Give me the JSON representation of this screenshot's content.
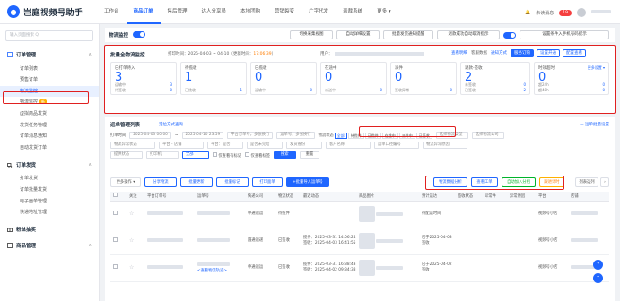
{
  "brand": {
    "logo_glyph": "●",
    "name": "岂庭视频号助手"
  },
  "topnav": [
    "工作台",
    "商品订单",
    "售后管理",
    "达人分享员",
    "本地团购",
    "营销裂变",
    "广字代发",
    "表裁系统",
    "更多 ▾"
  ],
  "topnav_active": 1,
  "top_right": {
    "message_label": "未读消息",
    "message_count": "19"
  },
  "sidebar": {
    "search_placeholder": "输入页面搜索 Q",
    "groups": [
      {
        "label": "订单管理",
        "items": [
          "订单列表",
          "预售订单",
          "物流监控",
          "物流监控 新",
          "虚拟商品发货",
          "发货任务管理",
          "订单消息通知",
          "自动发货订单"
        ]
      },
      {
        "label": "订单发货",
        "items": [
          "打单发货",
          "订单批量发货",
          "电子面单管理",
          "快递地址管理"
        ]
      },
      {
        "label": "粉丝抽奖",
        "items": []
      },
      {
        "label": "商品管理",
        "items": []
      }
    ],
    "new_tag": "新"
  },
  "toolbar": {
    "label": "物流监控",
    "buttons": [
      "切换采集视图",
      "自动详细设置",
      "批量发货通知提醒",
      "退款成功自动取消指示",
      "设置条件入手机号码提示"
    ]
  },
  "stats": {
    "title": "批量全物流监控",
    "print_label": "打印时间：",
    "date_range": "2025-04-03 ~ 04-10",
    "update_label": "（更新时间：",
    "update_time": "17:06:39",
    "update_close": "）",
    "user_label": "用户：",
    "links": [
      "查看明细",
      "客服数据",
      "通知方式"
    ],
    "btn_primary": "服务订购",
    "btn_outline1": "设置开通",
    "btn_outline2": "配置查看",
    "cards": [
      {
        "label": "已打单待入",
        "value": "3",
        "rows": [
          [
            "运输中",
            "3"
          ],
          [
            "待签收",
            "0"
          ]
        ]
      },
      {
        "label": "待揽收",
        "value": "1",
        "rows": [
          [
            "已揽收",
            "1"
          ]
        ]
      },
      {
        "label": "已揽收",
        "value": "0",
        "rows": [
          [
            "运输中",
            "0"
          ]
        ]
      },
      {
        "label": "在途中",
        "value": "0",
        "rows": [
          [
            "派送中",
            "0"
          ]
        ]
      },
      {
        "label": "派件",
        "value": "0",
        "rows": [
          [
            "签收异常",
            "0"
          ]
        ]
      },
      {
        "label": "退款-签收",
        "value": "2",
        "rows": [
          [
            "未签收",
            "0"
          ],
          [
            "已签收",
            "2"
          ]
        ]
      },
      {
        "label": "时效超时",
        "value": "0",
        "more": "更多设置 ▾",
        "rows": [
          [
            "超24h",
            "0"
          ],
          [
            "超48h",
            "0"
          ]
        ]
      }
    ]
  },
  "orders": {
    "title": "运单管理列表",
    "sublink": "定位方式查询",
    "rightlink": "— 运单批量设置",
    "filters_row1": {
      "time_label": "打单时间",
      "start": "2025-04-03 00:00",
      "sep": "~",
      "end": "2025-04-10 23:59",
      "order_no_ph": "平台订单号，多张换行",
      "waybill_ph": "运单号，多张换行",
      "logistics_label": "物流状态",
      "chips": [
        "全部",
        "待揽件",
        "已揽件",
        "在途中",
        "派件中",
        "已签收"
      ],
      "more1": "选择物流类型",
      "more2": "选择物流公司"
    },
    "filters_row2": [
      "物流异常状态",
      "平台 - 店铺",
      "平台：是否",
      "是否未完结",
      "发货省份",
      "客户名称",
      "运单口径编号",
      "物流异常原因"
    ],
    "filters_row3": {
      "items": [
        "提供状态",
        "打印机",
        "全部",
        "仅查看有标记",
        "仅查看标签"
      ],
      "btn_search": "搜索",
      "btn_reset": "重置"
    },
    "actions": {
      "export": "更多操作 ▾",
      "sync": "分享物流",
      "batch": "批量更新",
      "mark": "批量标记",
      "print": "打印面单",
      "add": "+批量导入运单号",
      "logistics_analysis": "物流数据分析",
      "view_abnormal": "查看工单",
      "auto_group": "自动加入分组",
      "follow_time": "跟进计时",
      "col_setting": "列表选列"
    },
    "columns": [
      "",
      "关注",
      "平台订单号",
      "运单号",
      "快递公司",
      "物流状态",
      "最近动态",
      "商品图片",
      "预计送达",
      "签收状态",
      "异常件",
      "异常原因",
      "平台",
      "店铺"
    ],
    "rows": [
      {
        "company": "申通速运",
        "status": "待揽件",
        "dyn1": "",
        "dyn2": "",
        "eta": "待配送时间",
        "platform": "视频号小店"
      },
      {
        "company": "圆通速递",
        "status": "已签收",
        "dyn1": "揽件：2025-03-31 14:06:24",
        "dyn2": "签收：2025-04-03 16:41:55",
        "eta": "已于2025-04-03 签收",
        "platform": "视频号小店"
      },
      {
        "company": "申通速运",
        "status": "已签收",
        "dyn1": "揽件：2025-03-31 16:38:43",
        "dyn2": "签收：2025-04-02 09:34:38",
        "eta": "已于2025-04-02 签收",
        "platform": "视频号小店"
      }
    ],
    "waybill_extra": "<查看物流轨迹>"
  },
  "accent": "#1f66ff",
  "highlight_color": "#e02020"
}
